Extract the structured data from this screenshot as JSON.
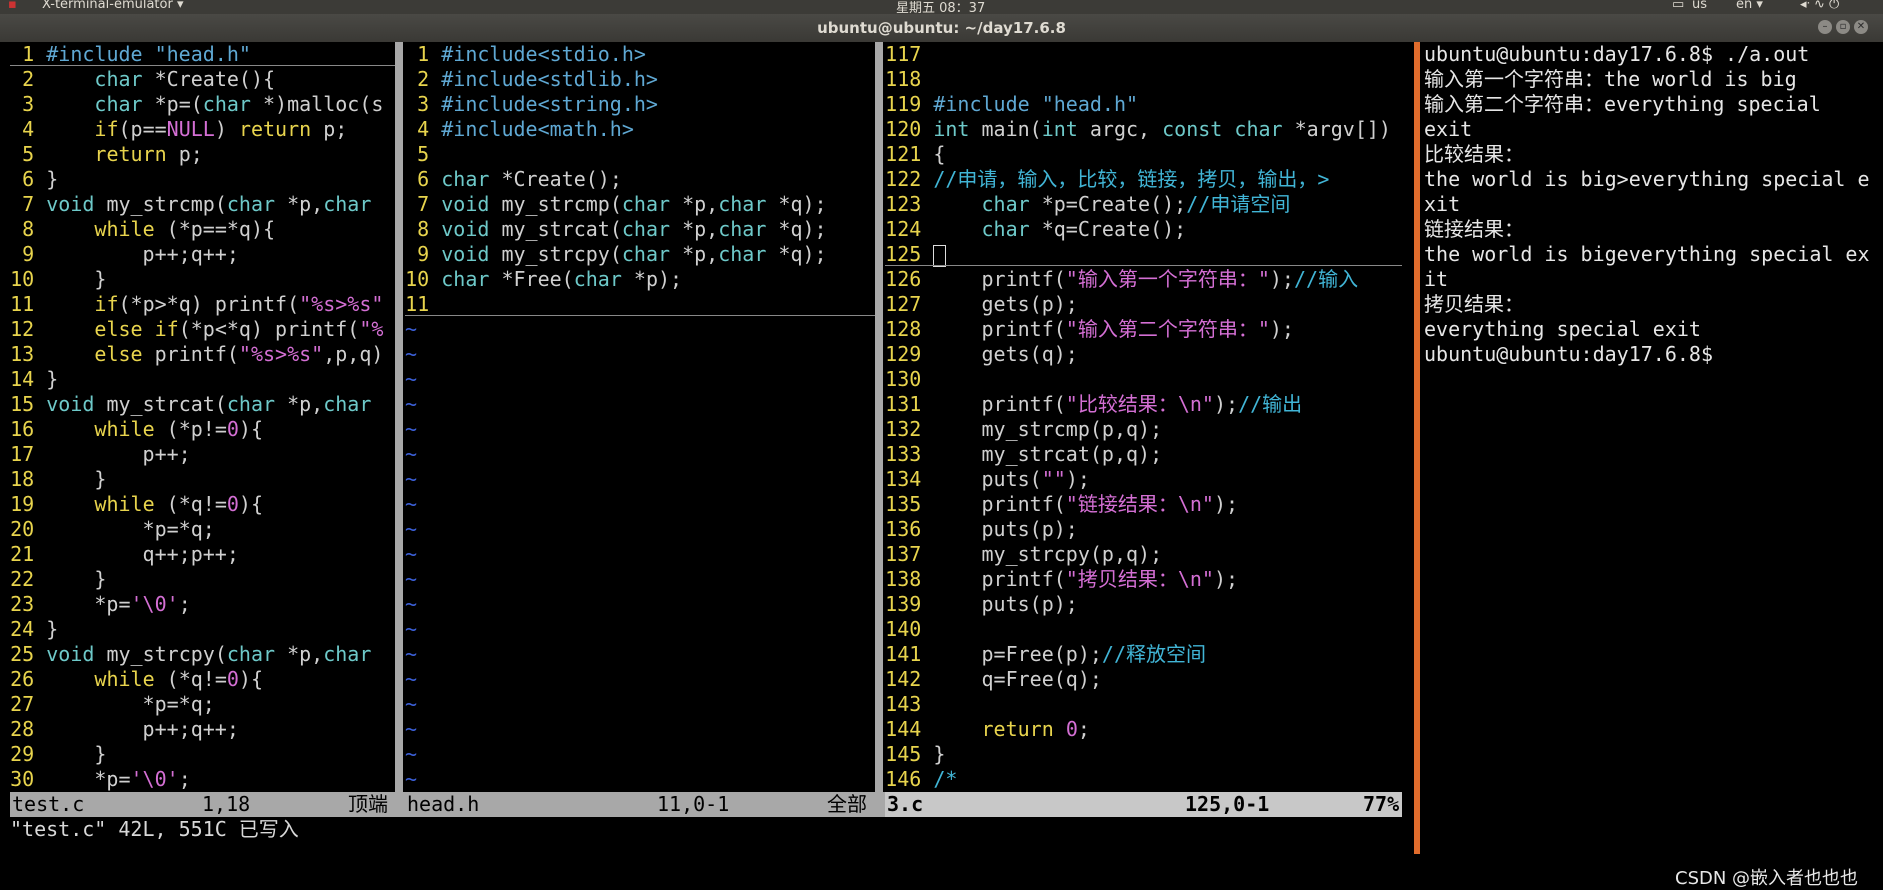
{
  "topbar": {
    "app_name": "X-terminal-emulator ▾",
    "clock": "星期五 08：37",
    "keyboard": "us",
    "lang": "en ▾",
    "tray": "◂ᐧ ∿ ⏻"
  },
  "window": {
    "title": "ubuntu@ubuntu: ~/day17.6.8"
  },
  "panes": [
    {
      "id": "test_c",
      "lines": [
        {
          "n": "1",
          "t": "#include \"head.h\""
        },
        {
          "n": "2",
          "t": "    char *Create(){"
        },
        {
          "n": "3",
          "t": "    char *p=(char *)malloc(s"
        },
        {
          "n": "4",
          "t": "    if(p==NULL) return p;"
        },
        {
          "n": "5",
          "t": "    return p;"
        },
        {
          "n": "6",
          "t": "}"
        },
        {
          "n": "7",
          "t": "void my_strcmp(char *p,char"
        },
        {
          "n": "8",
          "t": "    while (*p==*q){"
        },
        {
          "n": "9",
          "t": "        p++;q++;"
        },
        {
          "n": "10",
          "t": "    }"
        },
        {
          "n": "11",
          "t": "    if(*p>*q) printf(\"%s>%s\""
        },
        {
          "n": "12",
          "t": "    else if(*p<*q) printf(\"%"
        },
        {
          "n": "13",
          "t": "    else printf(\"%s>%s\",p,q)"
        },
        {
          "n": "14",
          "t": "}"
        },
        {
          "n": "15",
          "t": "void my_strcat(char *p,char"
        },
        {
          "n": "16",
          "t": "    while (*p!=0){"
        },
        {
          "n": "17",
          "t": "        p++;"
        },
        {
          "n": "18",
          "t": "    }"
        },
        {
          "n": "19",
          "t": "    while (*q!=0){"
        },
        {
          "n": "20",
          "t": "        *p=*q;"
        },
        {
          "n": "21",
          "t": "        q++;p++;"
        },
        {
          "n": "22",
          "t": "    }"
        },
        {
          "n": "23",
          "t": "    *p='\\0';"
        },
        {
          "n": "24",
          "t": "}"
        },
        {
          "n": "25",
          "t": "void my_strcpy(char *p,char"
        },
        {
          "n": "26",
          "t": "    while (*q!=0){"
        },
        {
          "n": "27",
          "t": "        *p=*q;"
        },
        {
          "n": "28",
          "t": "        p++;q++;"
        },
        {
          "n": "29",
          "t": "    }"
        },
        {
          "n": "30",
          "t": "    *p='\\0';"
        }
      ],
      "status": {
        "file": "test.c",
        "pos": "1,18",
        "scroll": "顶端"
      }
    },
    {
      "id": "head_h",
      "lines": [
        {
          "n": "1",
          "t": "#include<stdio.h>"
        },
        {
          "n": "2",
          "t": "#include<stdlib.h>"
        },
        {
          "n": "3",
          "t": "#include<string.h>"
        },
        {
          "n": "4",
          "t": "#include<math.h>"
        },
        {
          "n": "5",
          "t": ""
        },
        {
          "n": "6",
          "t": "char *Create();"
        },
        {
          "n": "7",
          "t": "void my_strcmp(char *p,char *q);"
        },
        {
          "n": "8",
          "t": "void my_strcat(char *p,char *q);"
        },
        {
          "n": "9",
          "t": "void my_strcpy(char *p,char *q);"
        },
        {
          "n": "10",
          "t": "char *Free(char *p);"
        },
        {
          "n": "11",
          "t": ""
        }
      ],
      "tilde": "~",
      "status": {
        "file": "head.h",
        "pos": "11,0-1",
        "scroll": "全部"
      }
    },
    {
      "id": "three_c",
      "lines": [
        {
          "n": "117",
          "t": ""
        },
        {
          "n": "118",
          "t": ""
        },
        {
          "n": "119",
          "t": "#include \"head.h\""
        },
        {
          "n": "120",
          "t": "int main(int argc, const char *argv[])"
        },
        {
          "n": "121",
          "t": "{"
        },
        {
          "n": "122",
          "t": "//申请，输入，比较，链接，拷贝，输出，>"
        },
        {
          "n": "123",
          "t": "    char *p=Create();//申请空间"
        },
        {
          "n": "124",
          "t": "    char *q=Create();"
        },
        {
          "n": "125",
          "t": ""
        },
        {
          "n": "126",
          "t": "    printf(\"输入第一个字符串：\");//输入"
        },
        {
          "n": "127",
          "t": "    gets(p);"
        },
        {
          "n": "128",
          "t": "    printf(\"输入第二个字符串：\");"
        },
        {
          "n": "129",
          "t": "    gets(q);"
        },
        {
          "n": "130",
          "t": ""
        },
        {
          "n": "131",
          "t": "    printf(\"比较结果：\\n\");//输出"
        },
        {
          "n": "132",
          "t": "    my_strcmp(p,q);"
        },
        {
          "n": "133",
          "t": "    my_strcat(p,q);"
        },
        {
          "n": "134",
          "t": "    puts(\"\");"
        },
        {
          "n": "135",
          "t": "    printf(\"链接结果：\\n\");"
        },
        {
          "n": "136",
          "t": "    puts(p);"
        },
        {
          "n": "137",
          "t": "    my_strcpy(p,q);"
        },
        {
          "n": "138",
          "t": "    printf(\"拷贝结果：\\n\");"
        },
        {
          "n": "139",
          "t": "    puts(p);"
        },
        {
          "n": "140",
          "t": ""
        },
        {
          "n": "141",
          "t": "    p=Free(p);//释放空间"
        },
        {
          "n": "142",
          "t": "    q=Free(q);"
        },
        {
          "n": "143",
          "t": ""
        },
        {
          "n": "144",
          "t": "    return 0;"
        },
        {
          "n": "145",
          "t": "}"
        },
        {
          "n": "146",
          "t": "/*"
        }
      ],
      "status": {
        "file": "3.c",
        "pos": "125,0-1",
        "scroll": "77%"
      }
    }
  ],
  "cmdline": "\"test.c\" 42L, 551C 已写入",
  "output": [
    "ubuntu@ubuntu:day17.6.8$ ./a.out",
    "输入第一个字符串：the world is big",
    "输入第二个字符串：everything special",
    "exit",
    "比较结果：",
    "the world is big>everything special e",
    "xit",
    "链接结果：",
    "the world is bigeverything special ex",
    "it",
    "拷贝结果：",
    "everything special exit",
    "ubuntu@ubuntu:day17.6.8$"
  ],
  "watermark": "CSDN @嵌入者也也也",
  "colors": {
    "line_number": "#e8d44d",
    "preprocessor": "#5fa8d3",
    "type": "#6ec9c9",
    "string": "#d46fd4",
    "comment": "#41b5d6",
    "tilde": "#3b5fd6",
    "statusbar": "#a8a8a8",
    "separator_accent": "#e06c2c"
  }
}
